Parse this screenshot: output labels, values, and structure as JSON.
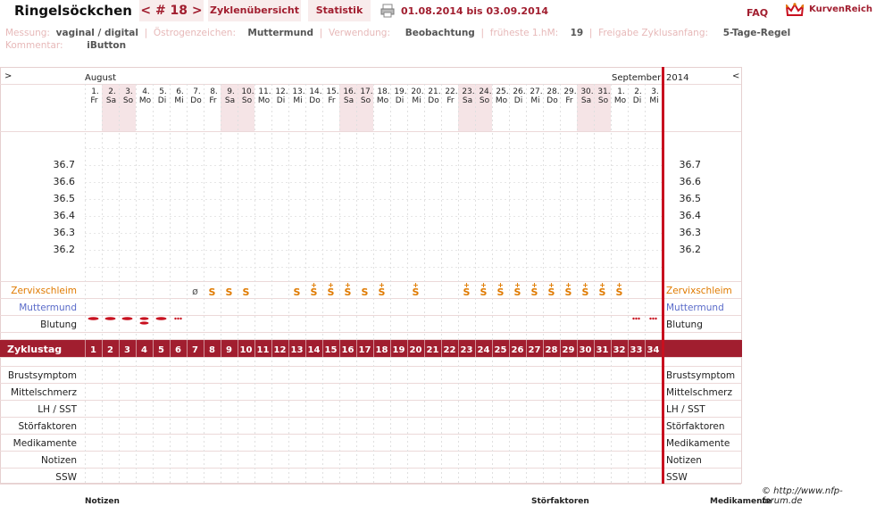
{
  "header": {
    "title": "Ringelsöckchen",
    "cycle_nav": "< # 18 >",
    "tab_overview": "Zyklenübersicht",
    "tab_stats": "Statistik",
    "period": "01.08.2014 bis 03.09.2014",
    "faq": "FAQ",
    "logo_text": "KurvenReich",
    "print_icon": "printer-icon",
    "logo_icon": "crown-icon"
  },
  "meta": {
    "measure_label": "Messung:",
    "measure_value": "vaginal / digital",
    "estrogen_label": "Östrogenzeichen:",
    "estrogen_value": "Muttermund",
    "use_label": "Verwendung:",
    "use_value": "Beobachtung",
    "earliest_label": "früheste 1.hM:",
    "earliest_value": "19",
    "release_label": "Freigabe Zyklusanfang:",
    "release_value": "5-Tage-Regel",
    "comment_label": "Kommentar:",
    "comment_value": "iButton",
    "separator": "|"
  },
  "chart_data": {
    "type": "table",
    "month_left": "August",
    "month_right": "September",
    "year": "2014",
    "nav_prev": ">",
    "nav_next": "<",
    "dates": [
      "1.",
      "2.",
      "3.",
      "4.",
      "5.",
      "6.",
      "7.",
      "8.",
      "9.",
      "10.",
      "11.",
      "12.",
      "13.",
      "14.",
      "15.",
      "16.",
      "17.",
      "18.",
      "19.",
      "20.",
      "21.",
      "22.",
      "23.",
      "24.",
      "25.",
      "26.",
      "27.",
      "28.",
      "29.",
      "30.",
      "31.",
      "1.",
      "2.",
      "3."
    ],
    "weekdays": [
      "Fr",
      "Sa",
      "So",
      "Mo",
      "Di",
      "Mi",
      "Do",
      "Fr",
      "Sa",
      "So",
      "Mo",
      "Di",
      "Mi",
      "Do",
      "Fr",
      "Sa",
      "So",
      "Mo",
      "Di",
      "Mi",
      "Do",
      "Fr",
      "Sa",
      "So",
      "Mo",
      "Di",
      "Mi",
      "Do",
      "Fr",
      "Sa",
      "So",
      "Mo",
      "Di",
      "Mi"
    ],
    "weekend_days": [
      2,
      3,
      9,
      10,
      16,
      17,
      23,
      24,
      30,
      31
    ],
    "temp_ticks": [
      "36.7",
      "36.6",
      "36.5",
      "36.4",
      "36.3",
      "36.2"
    ],
    "rows": {
      "cervix": "Zervixschleim",
      "cervix_pos": "Muttermund",
      "bleeding": "Blutung",
      "cycle_day": "Zyklustag",
      "breast": "Brustsymptom",
      "midpain": "Mittelschmerz",
      "lh": "LH / SST",
      "disturb": "Störfaktoren",
      "meds": "Medikamente",
      "notes": "Notizen",
      "ssw": "SSW"
    },
    "cervix_marks": [
      {
        "day": 7,
        "symbol": "ø"
      },
      {
        "day": 8,
        "symbol": "S"
      },
      {
        "day": 9,
        "symbol": "S"
      },
      {
        "day": 10,
        "symbol": "S"
      },
      {
        "day": 13,
        "symbol": "S"
      },
      {
        "day": 14,
        "symbol": "S+"
      },
      {
        "day": 15,
        "symbol": "S+"
      },
      {
        "day": 16,
        "symbol": "S+"
      },
      {
        "day": 17,
        "symbol": "S"
      },
      {
        "day": 18,
        "symbol": "S+"
      },
      {
        "day": 20,
        "symbol": "S+"
      },
      {
        "day": 23,
        "symbol": "S+"
      },
      {
        "day": 24,
        "symbol": "S+"
      },
      {
        "day": 25,
        "symbol": "S+"
      },
      {
        "day": 26,
        "symbol": "S+"
      },
      {
        "day": 27,
        "symbol": "S+"
      },
      {
        "day": 28,
        "symbol": "S+"
      },
      {
        "day": 29,
        "symbol": "S+"
      },
      {
        "day": 30,
        "symbol": "S+"
      },
      {
        "day": 31,
        "symbol": "S+"
      },
      {
        "day": 32,
        "symbol": "S+"
      }
    ],
    "bleeding": [
      {
        "day": 1,
        "level": "medium"
      },
      {
        "day": 2,
        "level": "medium"
      },
      {
        "day": 3,
        "level": "medium"
      },
      {
        "day": 4,
        "level": "heavy"
      },
      {
        "day": 5,
        "level": "medium"
      },
      {
        "day": 6,
        "level": "spotting"
      },
      {
        "day": 33,
        "level": "spotting"
      },
      {
        "day": 34,
        "level": "spotting"
      }
    ],
    "cycle_days": [
      "1",
      "2",
      "3",
      "4",
      "5",
      "6",
      "7",
      "8",
      "9",
      "10",
      "11",
      "12",
      "13",
      "14",
      "15",
      "16",
      "17",
      "18",
      "19",
      "20",
      "21",
      "22",
      "23",
      "24",
      "25",
      "26",
      "27",
      "28",
      "29",
      "30",
      "31",
      "32",
      "33",
      "34"
    ]
  },
  "footer": {
    "copyright": "© http://www.nfp-forum.de",
    "notes_label": "Notizen",
    "disturb_label": "Störfaktoren",
    "meds_label": "Medikamente"
  },
  "colors": {
    "accent": "#a11e2f",
    "cervix": "#e07a00",
    "muttermund": "#5a6bc9",
    "bleeding": "#c8101f",
    "weekend": "#f5e4e6"
  }
}
